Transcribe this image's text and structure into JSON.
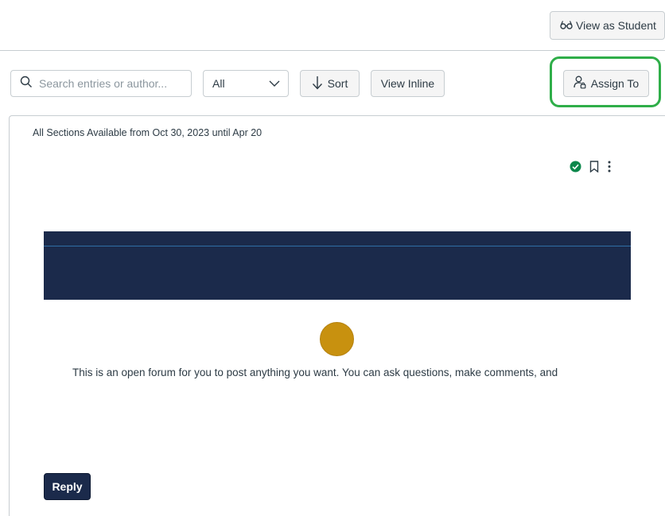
{
  "header": {
    "view_as_student_label": "View as Student"
  },
  "toolbar": {
    "search_placeholder": "Search entries or author...",
    "filter_selected": "All",
    "sort_label": "Sort",
    "view_inline_label": "View Inline",
    "assign_to_label": "Assign To"
  },
  "post": {
    "availability": "All Sections Available from Oct 30, 2023 until Apr 20",
    "message": "This is an open forum for you to post anything you want. You can ask questions, make comments, and",
    "reply_label": "Reply",
    "published": true
  },
  "colors": {
    "accent_navy": "#1b2a4b",
    "published_green": "#0b874b",
    "highlight_green": "#2fae49",
    "avatar_gold": "#c8910f"
  },
  "icons": [
    "glasses-icon",
    "search-icon",
    "chevron-down-icon",
    "arrow-down-icon",
    "user-lock-icon",
    "published-check-icon",
    "bookmark-icon",
    "kebab-menu-icon"
  ]
}
